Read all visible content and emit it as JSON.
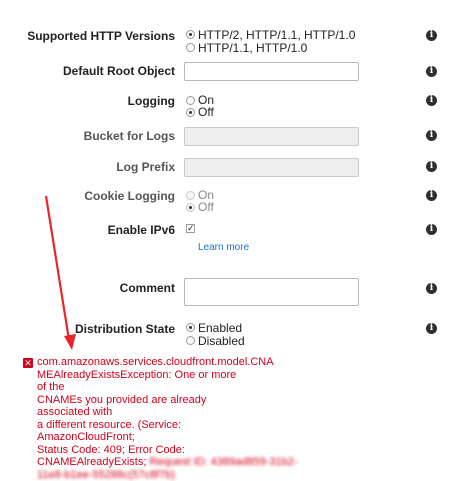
{
  "fields": {
    "http_versions": {
      "label": "Supported HTTP Versions",
      "options": [
        "HTTP/2, HTTP/1.1, HTTP/1.0",
        "HTTP/1.1, HTTP/1.0"
      ],
      "selected": "HTTP/2, HTTP/1.1, HTTP/1.0"
    },
    "default_root_object": {
      "label": "Default Root Object",
      "value": ""
    },
    "logging": {
      "label": "Logging",
      "options": [
        "On",
        "Off"
      ],
      "selected": "Off"
    },
    "bucket_for_logs": {
      "label": "Bucket for Logs",
      "value": ""
    },
    "log_prefix": {
      "label": "Log Prefix",
      "value": ""
    },
    "cookie_logging": {
      "label": "Cookie Logging",
      "options": [
        "On",
        "Off"
      ],
      "selected": "Off"
    },
    "enable_ipv6": {
      "label": "Enable IPv6",
      "checked": true,
      "learn_more": "Learn more"
    },
    "comment": {
      "label": "Comment",
      "value": ""
    },
    "distribution_state": {
      "label": "Distribution State",
      "options": [
        "Enabled",
        "Disabled"
      ],
      "selected": "Enabled"
    }
  },
  "error": {
    "lines": [
      "com.amazonaws.services.cloudfront.model.CNA",
      "MEAlreadyExistsException: One or more of the",
      "CNAMEs you provided are already associated with",
      "a different resource. (Service: AmazonCloudFront;",
      "Status Code: 409; Error Code:"
    ],
    "last_line_prefix": "CNAMEAlreadyExists;",
    "redacted_1": "Request ID: 4389ad859-31b2-",
    "redacted_2": "11e8-b1ee-55288c(57c8f7b)",
    "colors": {
      "error_red": "#d0021b",
      "arrow_red": "#e8262a",
      "link_blue": "#1a73c9"
    }
  },
  "icons": {
    "info": "info-icon",
    "error": "error-x-icon",
    "annotation": "red-arrow-annotation"
  }
}
